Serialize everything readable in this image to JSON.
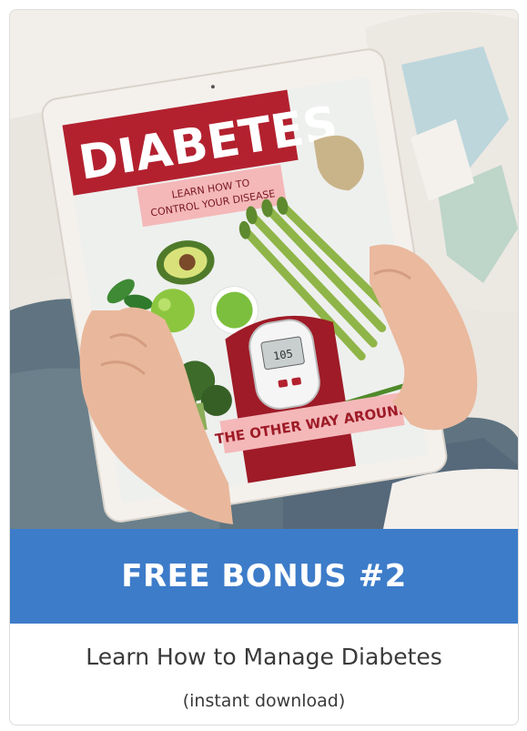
{
  "cover": {
    "title": "DIABETES",
    "subtitle_line1": "LEARN HOW TO",
    "subtitle_line2": "CONTROL YOUR DISEASE",
    "tagline": "THE OTHER WAY AROUND",
    "meter_reading": "105"
  },
  "banner": {
    "label": "FREE BONUS #2"
  },
  "description": {
    "title": "Learn How to Manage Diabetes",
    "note": "(instant download)"
  },
  "colors": {
    "banner": "#3d7cc9",
    "cover_red": "#b3212f",
    "text": "#3a3a3a"
  }
}
